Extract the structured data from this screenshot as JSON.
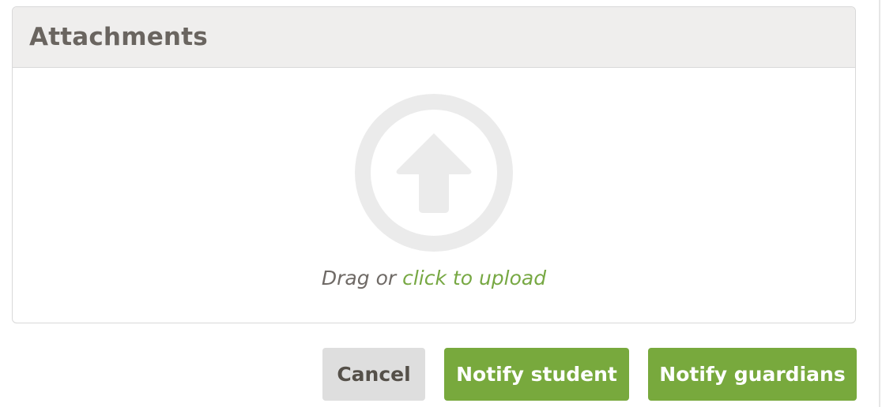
{
  "attachments": {
    "title": "Attachments",
    "dropzone": {
      "icon": "upload-arrow-circle-icon",
      "prefix_text": "Drag or ",
      "link_text": "click to upload"
    }
  },
  "actions": {
    "cancel_label": "Cancel",
    "notify_student_label": "Notify student",
    "notify_guardians_label": "Notify guardians"
  },
  "colors": {
    "accent_green": "#78a93d",
    "link_green": "#77a843",
    "header_bg": "#efeeed",
    "cancel_bg": "#dedede",
    "icon_gray": "#ebebeb"
  }
}
